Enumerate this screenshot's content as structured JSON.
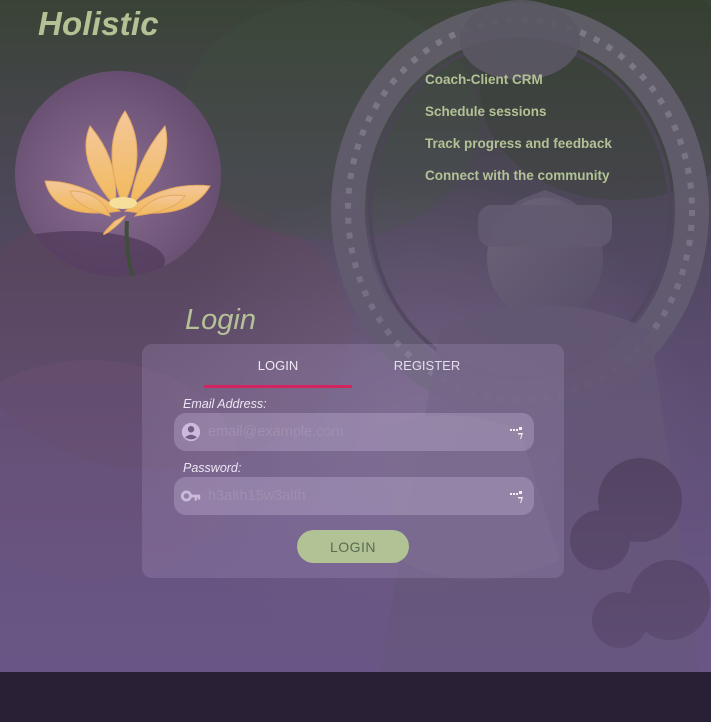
{
  "brand": {
    "title": "Holistic"
  },
  "features": [
    "Coach-Client CRM",
    "Schedule sessions",
    "Track progress and feedback",
    "Connect with the community"
  ],
  "login": {
    "heading": "Login",
    "tabs": {
      "login": "LOGIN",
      "register": "REGISTER"
    },
    "email": {
      "label": "Email Address:",
      "placeholder": "email@example.com"
    },
    "password": {
      "label": "Password:",
      "placeholder": "h3alth15w3alth"
    },
    "submit": "LOGIN"
  },
  "colors": {
    "accent_green": "#b1c295",
    "tab_underline": "#d3245f",
    "footer": "#2a2035",
    "overlay_purple": "#6a5686"
  },
  "icons": {
    "email_field": "account-circle-icon",
    "password_field": "key-icon",
    "field_addon": "password-manager-icon"
  }
}
